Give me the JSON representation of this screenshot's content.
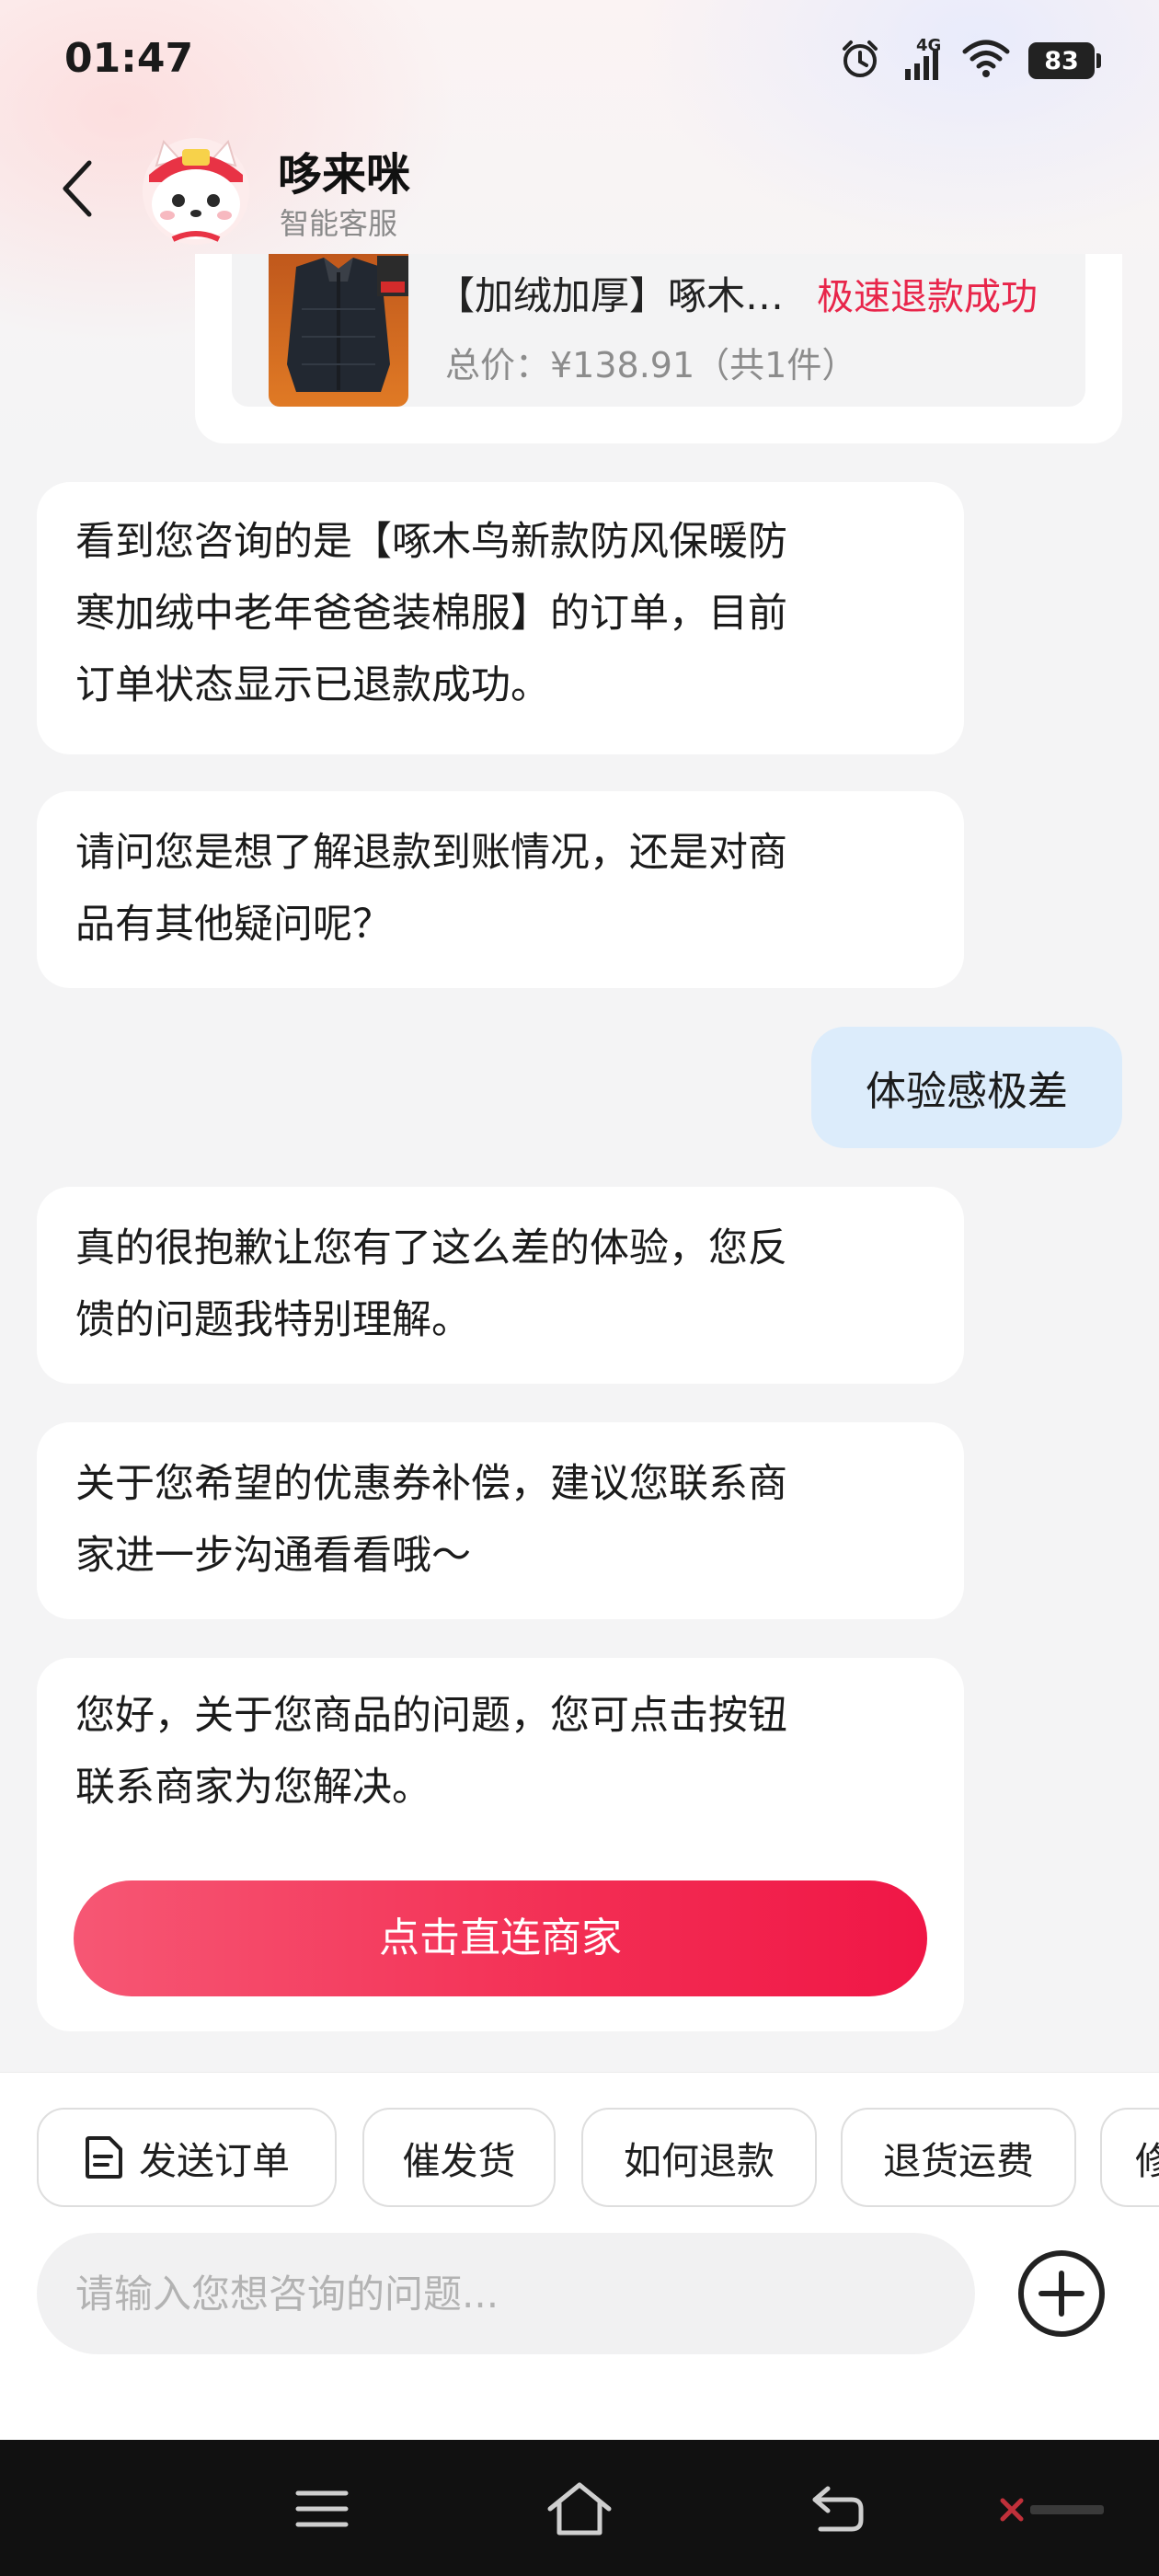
{
  "status_bar": {
    "time": "01:47",
    "network": "4G",
    "battery": "83"
  },
  "header": {
    "bot_name": "哆来咪",
    "bot_subtitle": "智能客服"
  },
  "order_card": {
    "title": "【加绒加厚】啄木鸟新款防风保暖防寒加绒中老年爸爸装棉服",
    "status": "极速退款成功",
    "price_text": "总价：¥138.91（共1件）"
  },
  "messages": [
    {
      "from": "bot",
      "lines": [
        "看到您咨询的是【啄木鸟新款防风保暖防",
        "寒加绒中老年爸爸装棉服】的订单，目前",
        "订单状态显示已退款成功。"
      ]
    },
    {
      "from": "bot",
      "lines": [
        "请问您是想了解退款到账情况，还是对商",
        "品有其他疑问呢？"
      ]
    },
    {
      "from": "user",
      "text": "体验感极差"
    },
    {
      "from": "bot",
      "lines": [
        "真的很抱歉让您有了这么差的体验，您反",
        "馈的问题我特别理解。"
      ]
    },
    {
      "from": "bot",
      "lines": [
        "关于您希望的优惠券补偿，建议您联系商",
        "家进一步沟通看看哦～"
      ]
    },
    {
      "from": "bot",
      "lines": [
        "您好，关于您商品的问题，您可点击按钮",
        "联系商家为您解决。"
      ],
      "button_label": "点击直连商家"
    }
  ],
  "quick_actions": [
    "发送订单",
    "催发货",
    "如何退款",
    "退货运费",
    "修改地址"
  ],
  "input": {
    "placeholder": "请输入您想咨询的问题..."
  },
  "colors": {
    "accent": "#f32d53",
    "user_bubble": "#dcecfb",
    "status_red": "#e8254a"
  },
  "icons": {
    "back": "chevron-left-icon",
    "alarm": "alarm-icon",
    "signal": "signal-icon",
    "wifi": "wifi-icon",
    "order": "document-icon",
    "plus": "plus-circle-icon",
    "nav_menu": "menu-icon",
    "nav_home": "home-icon",
    "nav_back": "back-icon"
  }
}
